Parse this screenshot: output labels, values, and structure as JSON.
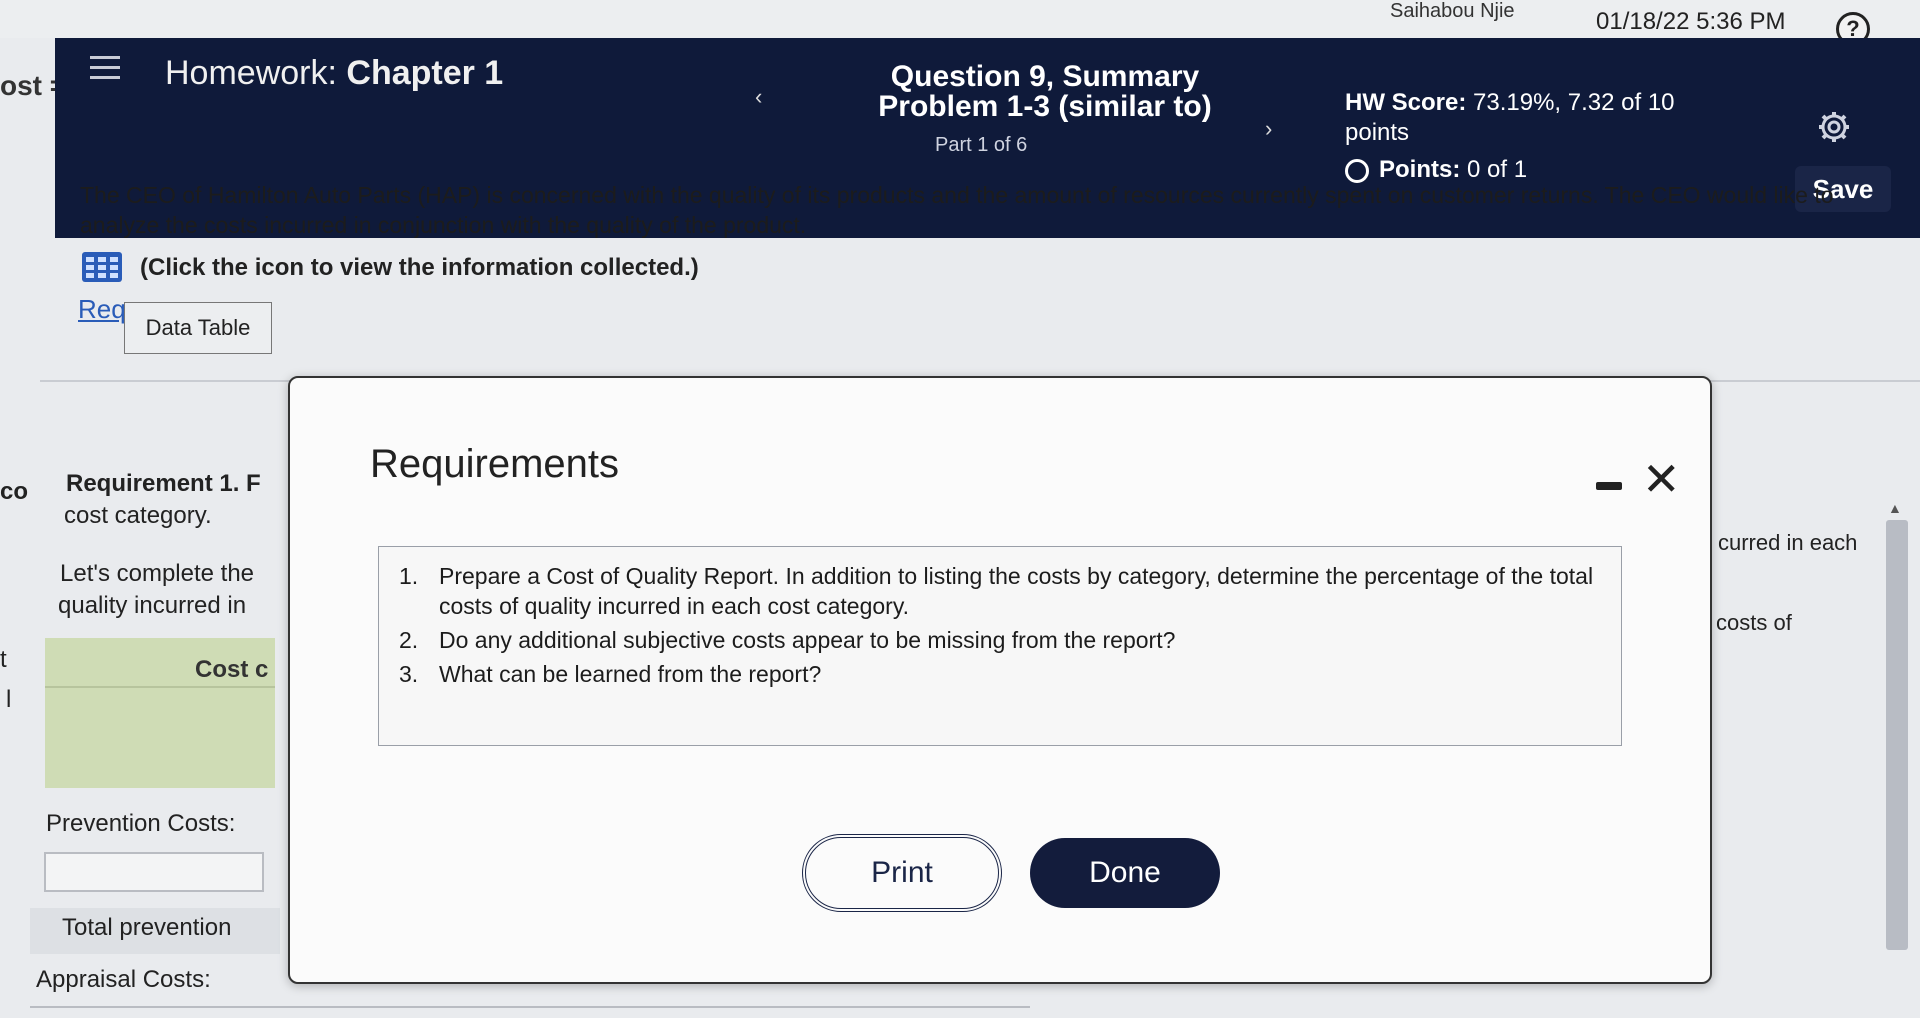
{
  "top": {
    "username": "Saihabou Njie",
    "datetime": "01/18/22 5:36 PM",
    "help_icon": "?"
  },
  "header": {
    "left_clip": "ost =",
    "hw_prefix": "Homework:",
    "hw_name": "Chapter 1",
    "prev": "‹",
    "next": "›",
    "question_line1": "Question 9, Summary",
    "question_line2": "Problem 1-3 (similar to)",
    "part": "Part 1 of 6",
    "hw_score_label": "HW Score:",
    "hw_score_value": "73.19%, 7.32 of 10 points",
    "points_label": "Points:",
    "points_value": "0 of 1",
    "save_label": "Save"
  },
  "content": {
    "intro": "The CEO of Hamilton Auto Parts (HAP) is concerned with the quality of its products and the amount of resources currently spent on customer returns. The CEO would like to analyze the costs incurred in conjunction with the quality of the product.",
    "click_text": "(Click the icon to view the information collected.)",
    "req_link": "Req",
    "data_table_tab": "Data Table",
    "bg_left_co": "co",
    "bg_req1": "Requirement 1. F",
    "bg_cost_category": "cost category.",
    "bg_complete": "Let's complete the",
    "bg_quality": "quality incurred in",
    "bg_cost_header": "Cost c",
    "bg_prevention": "Prevention Costs:",
    "bg_total_prevention": "Total prevention",
    "bg_appraisal": "Appraisal Costs:",
    "bg_right1": "curred in each",
    "bg_right2": "costs of",
    "bg_left_t": "t",
    "bg_left_l": "l"
  },
  "modal": {
    "title": "Requirements",
    "requirements": [
      {
        "num": "1.",
        "text": "Prepare a Cost of Quality Report. In addition to listing the costs by category, determine the percentage of the total costs of quality incurred in each cost category."
      },
      {
        "num": "2.",
        "text": "Do any additional subjective costs appear to be missing from the report?"
      },
      {
        "num": "3.",
        "text": "What can be learned from the report?"
      }
    ],
    "print_label": "Print",
    "done_label": "Done"
  },
  "colors": {
    "header_bg": "#0f1a3a",
    "accent_blue": "#2a5cb8",
    "done_bg": "#131c3c",
    "cost_col_bg": "#cfdcb5"
  }
}
